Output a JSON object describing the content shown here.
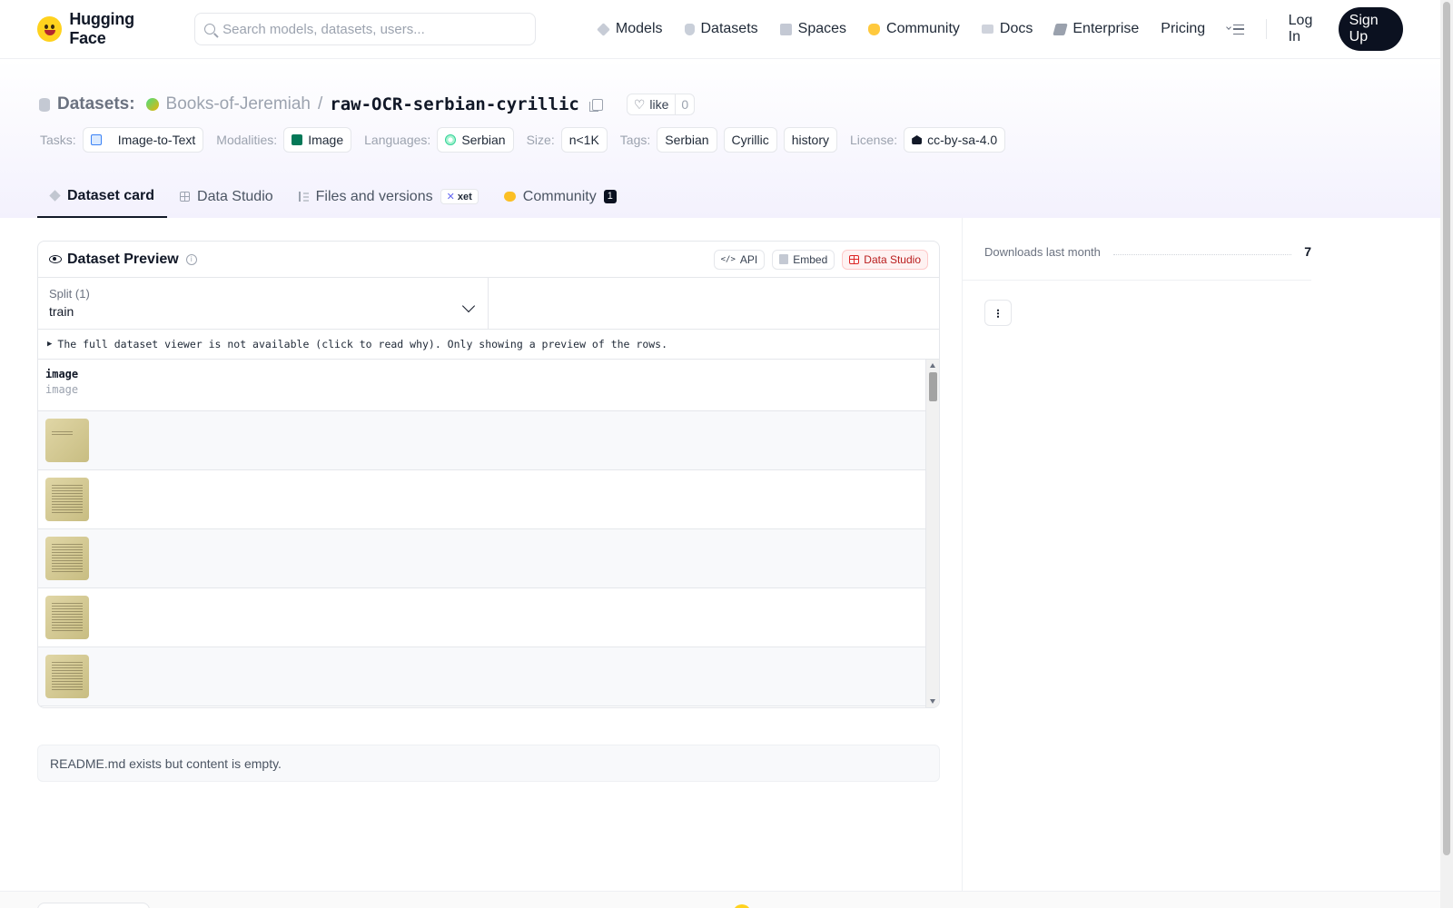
{
  "brand": {
    "name": "Hugging Face"
  },
  "search": {
    "placeholder": "Search models, datasets, users..."
  },
  "nav": {
    "items": [
      {
        "label": "Models",
        "icon": "cube-icon"
      },
      {
        "label": "Datasets",
        "icon": "database-icon"
      },
      {
        "label": "Spaces",
        "icon": "grid-icon"
      },
      {
        "label": "Community",
        "icon": "hugging-face-icon"
      },
      {
        "label": "Docs",
        "icon": "book-icon"
      },
      {
        "label": "Enterprise",
        "icon": "enterprise-icon"
      },
      {
        "label": "Pricing"
      }
    ],
    "login": "Log In",
    "signup": "Sign Up"
  },
  "header": {
    "section": "Datasets:",
    "org": "Books-of-Jeremiah",
    "separator": "/",
    "repo": "raw-OCR-serbian-cyrillic",
    "like_label": "like",
    "like_count": "0"
  },
  "meta": {
    "tasks_label": "Tasks:",
    "task": "Image-to-Text",
    "modalities_label": "Modalities:",
    "modality": "Image",
    "languages_label": "Languages:",
    "language": "Serbian",
    "size_label": "Size:",
    "size": "n<1K",
    "tags_label": "Tags:",
    "tags": [
      "Serbian",
      "Cyrillic",
      "history"
    ],
    "license_label": "License:",
    "license": "cc-by-sa-4.0"
  },
  "tabs": {
    "card": "Dataset card",
    "studio": "Data Studio",
    "files": "Files and versions",
    "xet": "xet",
    "community": "Community",
    "community_count": "1"
  },
  "preview": {
    "title": "Dataset Preview",
    "api": "API",
    "embed": "Embed",
    "studio": "Data Studio",
    "split_label": "Split (1)",
    "split_value": "train",
    "notice": "The full dataset viewer is not available (click to read why). Only showing a preview of the rows.",
    "column": {
      "name": "image",
      "type": "image"
    },
    "rows": 5
  },
  "readme": {
    "text": "README.md exists but content is empty."
  },
  "sidebar": {
    "downloads_label": "Downloads last month",
    "downloads_value": "7"
  }
}
